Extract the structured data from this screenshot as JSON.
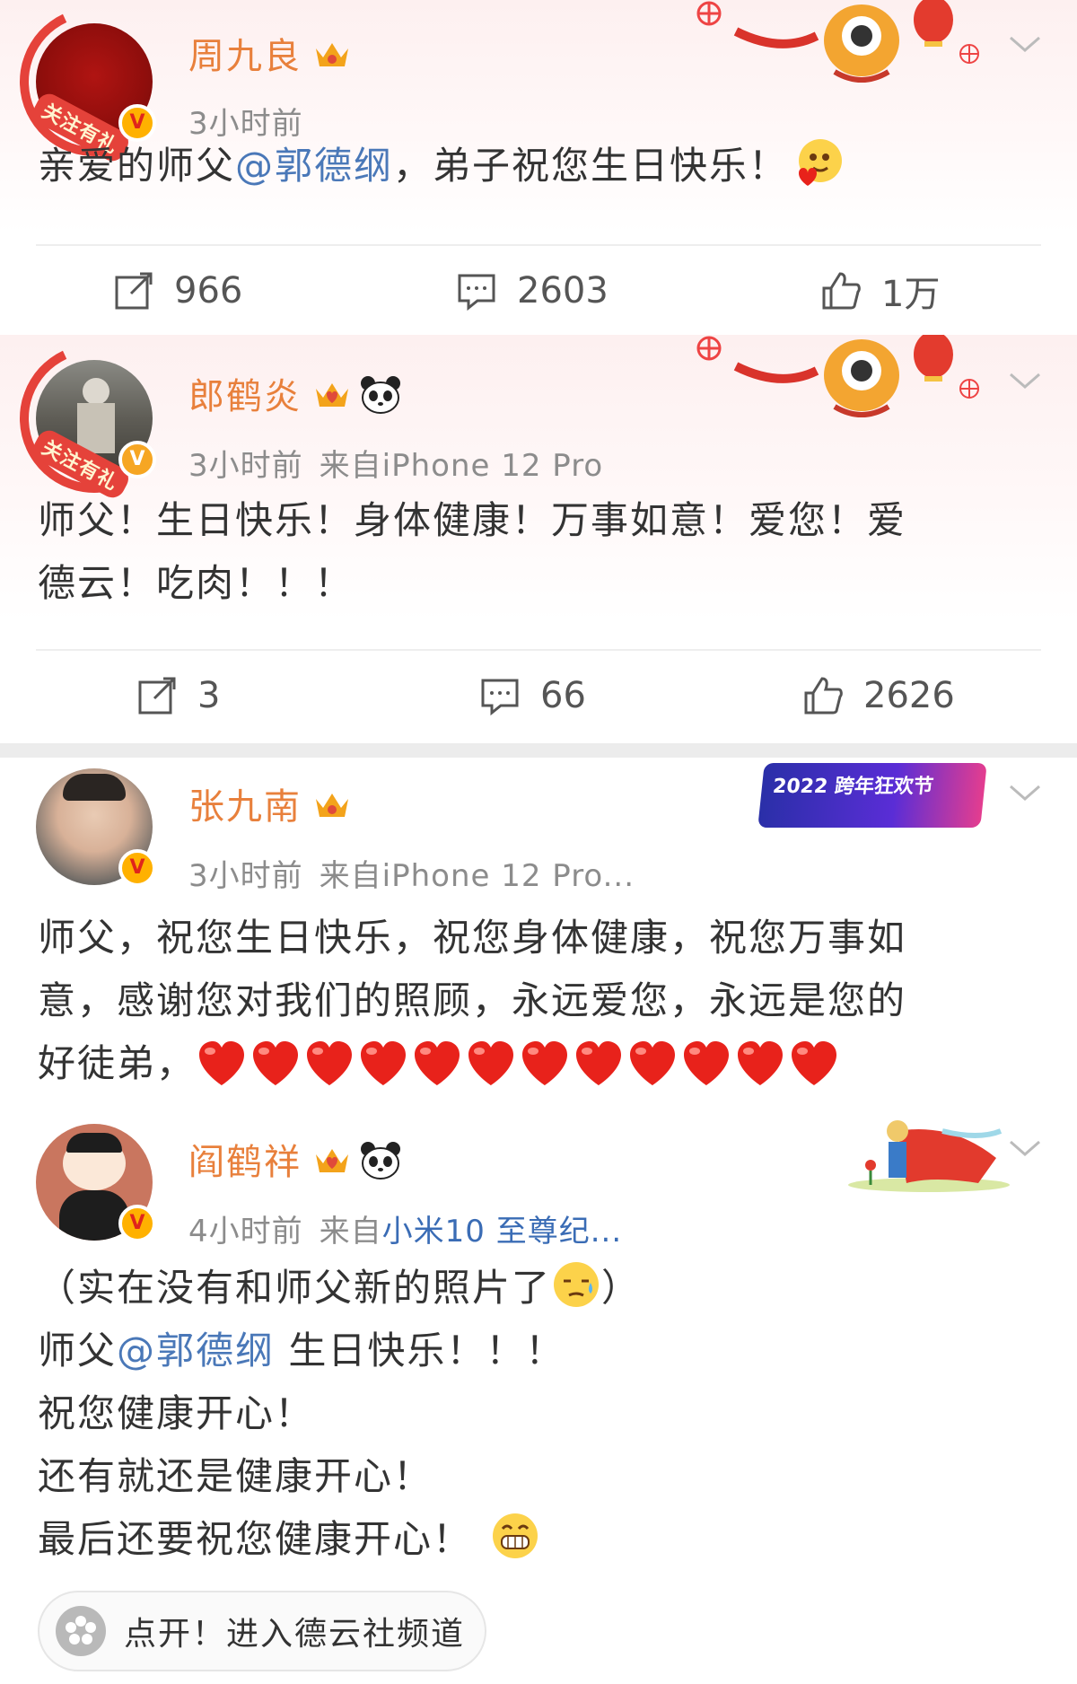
{
  "posts": [
    {
      "name": "周九良",
      "time": "3小时前",
      "source": "",
      "device": "",
      "content_pre": "亲爱的师父",
      "mention": "@郭德纲",
      "content_post": "，弟子祝您生日快乐！",
      "actions": {
        "repost": "966",
        "comment": "2603",
        "like": "1万"
      }
    },
    {
      "name": "郎鹤炎",
      "time": "3小时前",
      "source": "来自iPhone 12 Pro",
      "device": "",
      "content_lines": [
        "师父！生日快乐！身体健康！万事如意！爱您！爱",
        "德云！吃肉！！！"
      ],
      "actions": {
        "repost": "3",
        "comment": "66",
        "like": "2626"
      }
    },
    {
      "name": "张九南",
      "time": "3小时前",
      "source": "来自iPhone 12 Pro...",
      "banner": "2022 跨年狂欢节",
      "content_lines": [
        "师父，祝您生日快乐，祝您身体健康，祝您万事如",
        "意，感谢您对我们的照顾，永远爱您，永远是您的",
        "好徒弟，"
      ]
    },
    {
      "name": "阎鹤祥",
      "time": "4小时前",
      "source": "来自",
      "device": "小米10 至尊纪...",
      "line1": "（实在没有和师父新的照片了",
      "line1_end": "）",
      "line2_pre": "师父",
      "mention": "@郭德纲",
      "line2_post": " 生日快乐！！！",
      "line3": "祝您健康开心！",
      "line4": "还有就还是健康开心！",
      "line5": "最后还要祝您健康开心！",
      "channel": "点开！进入德云社频道"
    }
  ],
  "gift_tag": "关注有礼",
  "verified_mark": "V",
  "colors": {
    "name": "#e8803c",
    "link": "#4a78b8",
    "meta": "#8c8c8c",
    "heart": "#e8221b",
    "crown": "#f3a31b"
  }
}
